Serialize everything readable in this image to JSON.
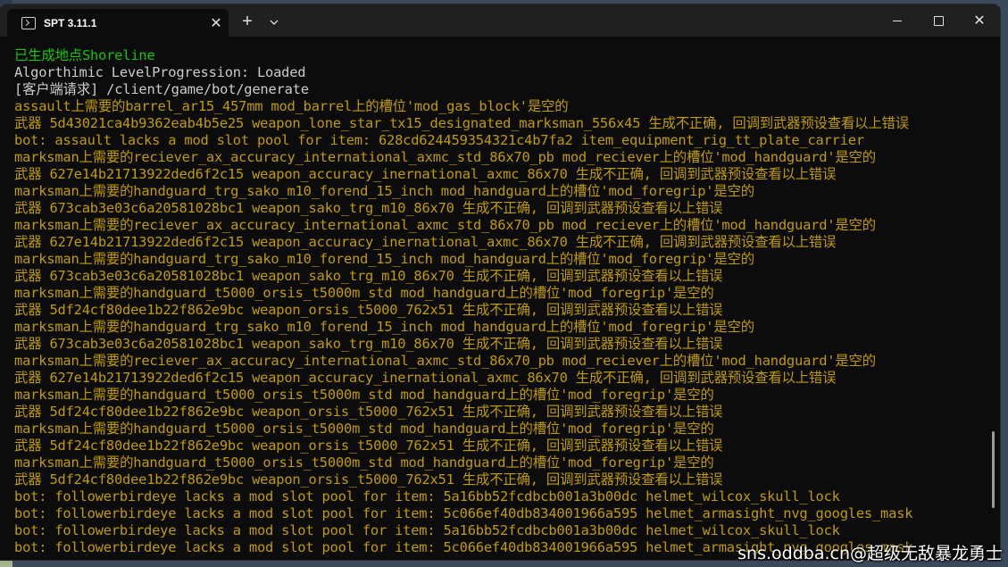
{
  "window": {
    "tab_title": "SPT 3.11.1",
    "new_tab_label": "+",
    "close_tab_label": "✕",
    "close_window_label": "✕"
  },
  "console": {
    "lines": [
      {
        "text": "已生成地点Shoreline",
        "color": "green"
      },
      {
        "text": "Algorthimic LevelProgression: Loaded",
        "color": "white"
      },
      {
        "text": "[客户端请求] /client/game/bot/generate",
        "color": "white"
      },
      {
        "text": "assault上需要的barrel_ar15_457mm mod_barrel上的槽位'mod_gas_block'是空的",
        "color": "yellow"
      },
      {
        "text": "武器 5d43021ca4b9362eab4b5e25 weapon_lone_star_tx15_designated_marksman_556x45 生成不正确, 回调到武器预设查看以上错误",
        "color": "yellow"
      },
      {
        "text": "bot: assault lacks a mod slot pool for item: 628cd624459354321c4b7fa2 item_equipment_rig_tt_plate_carrier",
        "color": "yellow"
      },
      {
        "text": "marksman上需要的reciever_ax_accuracy_international_axmc_std_86x70_pb mod_reciever上的槽位'mod_handguard'是空的",
        "color": "yellow"
      },
      {
        "text": "武器 627e14b21713922ded6f2c15 weapon_accuracy_inernational_axmc_86x70 生成不正确, 回调到武器预设查看以上错误",
        "color": "yellow"
      },
      {
        "text": "marksman上需要的handguard_trg_sako_m10_forend_15_inch mod_handguard上的槽位'mod_foregrip'是空的",
        "color": "yellow"
      },
      {
        "text": "武器 673cab3e03c6a20581028bc1 weapon_sako_trg_m10_86x70 生成不正确, 回调到武器预设查看以上错误",
        "color": "yellow"
      },
      {
        "text": "marksman上需要的reciever_ax_accuracy_international_axmc_std_86x70_pb mod_reciever上的槽位'mod_handguard'是空的",
        "color": "yellow"
      },
      {
        "text": "武器 627e14b21713922ded6f2c15 weapon_accuracy_inernational_axmc_86x70 生成不正确, 回调到武器预设查看以上错误",
        "color": "yellow"
      },
      {
        "text": "marksman上需要的handguard_trg_sako_m10_forend_15_inch mod_handguard上的槽位'mod_foregrip'是空的",
        "color": "yellow"
      },
      {
        "text": "武器 673cab3e03c6a20581028bc1 weapon_sako_trg_m10_86x70 生成不正确, 回调到武器预设查看以上错误",
        "color": "yellow"
      },
      {
        "text": "marksman上需要的handguard_t5000_orsis_t5000m_std mod_handguard上的槽位'mod_foregrip'是空的",
        "color": "yellow"
      },
      {
        "text": "武器 5df24cf80dee1b22f862e9bc weapon_orsis_t5000_762x51 生成不正确, 回调到武器预设查看以上错误",
        "color": "yellow"
      },
      {
        "text": "marksman上需要的handguard_trg_sako_m10_forend_15_inch mod_handguard上的槽位'mod_foregrip'是空的",
        "color": "yellow"
      },
      {
        "text": "武器 673cab3e03c6a20581028bc1 weapon_sako_trg_m10_86x70 生成不正确, 回调到武器预设查看以上错误",
        "color": "yellow"
      },
      {
        "text": "marksman上需要的reciever_ax_accuracy_international_axmc_std_86x70_pb mod_reciever上的槽位'mod_handguard'是空的",
        "color": "yellow"
      },
      {
        "text": "武器 627e14b21713922ded6f2c15 weapon_accuracy_inernational_axmc_86x70 生成不正确, 回调到武器预设查看以上错误",
        "color": "yellow"
      },
      {
        "text": "marksman上需要的handguard_t5000_orsis_t5000m_std mod_handguard上的槽位'mod_foregrip'是空的",
        "color": "yellow"
      },
      {
        "text": "武器 5df24cf80dee1b22f862e9bc weapon_orsis_t5000_762x51 生成不正确, 回调到武器预设查看以上错误",
        "color": "yellow"
      },
      {
        "text": "marksman上需要的handguard_t5000_orsis_t5000m_std mod_handguard上的槽位'mod_foregrip'是空的",
        "color": "yellow"
      },
      {
        "text": "武器 5df24cf80dee1b22f862e9bc weapon_orsis_t5000_762x51 生成不正确, 回调到武器预设查看以上错误",
        "color": "yellow"
      },
      {
        "text": "marksman上需要的handguard_t5000_orsis_t5000m_std mod_handguard上的槽位'mod_foregrip'是空的",
        "color": "yellow"
      },
      {
        "text": "武器 5df24cf80dee1b22f862e9bc weapon_orsis_t5000_762x51 生成不正确, 回调到武器预设查看以上错误",
        "color": "yellow"
      },
      {
        "text": "bot: followerbirdeye lacks a mod slot pool for item: 5a16bb52fcdbcb001a3b00dc helmet_wilcox_skull_lock",
        "color": "yellow"
      },
      {
        "text": "bot: followerbirdeye lacks a mod slot pool for item: 5c066ef40db834001966a595 helmet_armasight_nvg_googles_mask",
        "color": "yellow"
      },
      {
        "text": "bot: followerbirdeye lacks a mod slot pool for item: 5a16bb52fcdbcb001a3b00dc helmet_wilcox_skull_lock",
        "color": "yellow"
      },
      {
        "text": "bot: followerbirdeye lacks a mod slot pool for item: 5c066ef40db834001966a595 helmet_armasight_nvg_googles_mask",
        "color": "yellow"
      }
    ]
  },
  "watermark": "sns.oddba.cn@超级无敌暴龙勇士",
  "colors": {
    "green": "#16c60c",
    "white": "#cccccc",
    "yellow": "#c19c00",
    "background": "#0c0c0c",
    "titlebar": "#202020"
  }
}
